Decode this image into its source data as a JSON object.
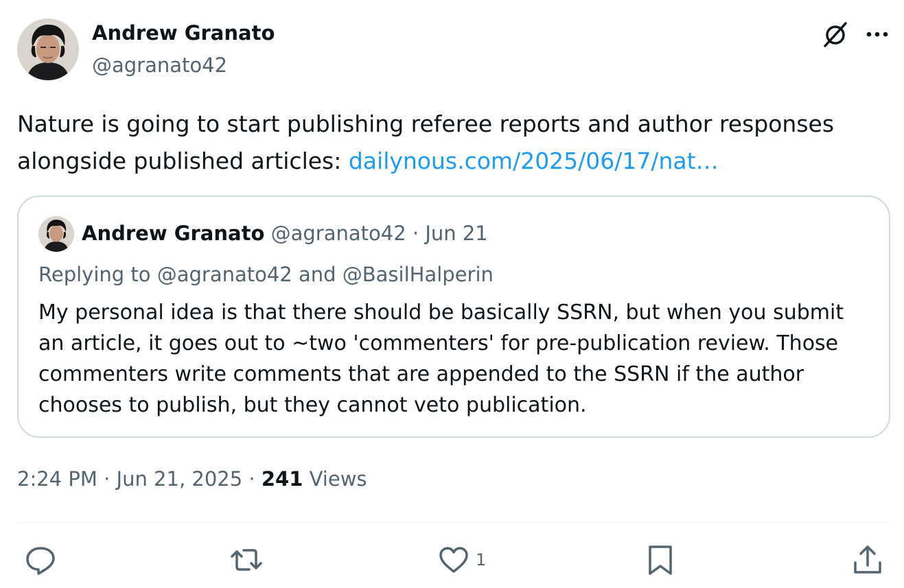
{
  "author": {
    "name": "Andrew Granato",
    "handle": "@agranato42"
  },
  "tweet": {
    "text": "Nature is going to start publishing referee reports and author responses alongside published articles: ",
    "link_text": "dailynous.com/2025/06/17/nat…"
  },
  "quote": {
    "name": "Andrew Granato",
    "handle": "@agranato42",
    "separator": "·",
    "date": "Jun 21",
    "replying_prefix": "Replying to ",
    "reply_to_1": "@agranato42",
    "reply_and": " and ",
    "reply_to_2": "@BasilHalperin",
    "text": "My personal idea is that there should be basically SSRN, but when you submit an article, it goes out to ~two 'commenters' for pre-publication review. Those commenters write comments that are appended to the SSRN if the author chooses to publish, but they cannot veto publication."
  },
  "meta": {
    "time": "2:24 PM",
    "sep": " · ",
    "date": "Jun 21, 2025",
    "views_count": "241",
    "views_label": "Views"
  },
  "actions": {
    "reply_icon": "reply-icon",
    "retweet_icon": "retweet-icon",
    "like_icon": "heart-icon",
    "like_count": "1",
    "bookmark_icon": "bookmark-icon",
    "share_icon": "share-icon"
  },
  "colors": {
    "text": "#0f1419",
    "secondary": "#536471",
    "link": "#1d9bf0",
    "border": "#cfd9de"
  }
}
